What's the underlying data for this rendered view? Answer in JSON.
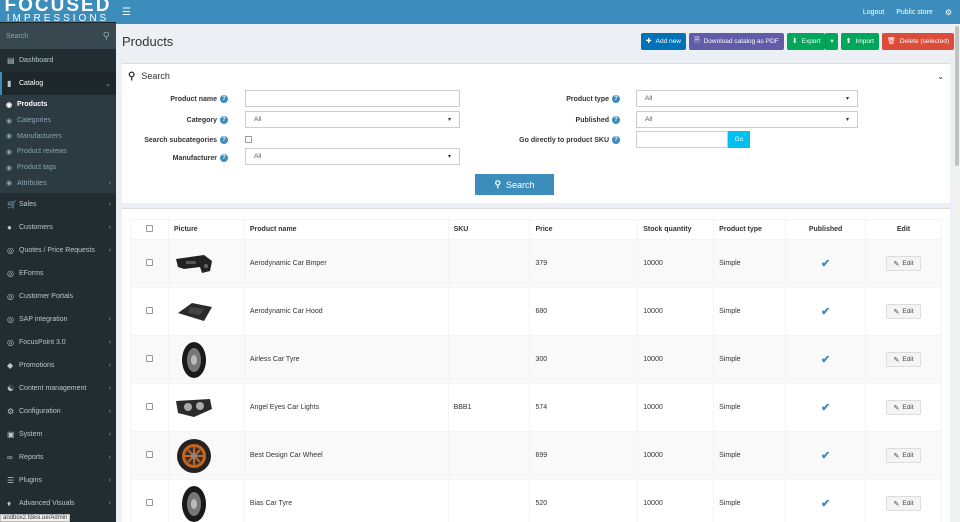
{
  "brand": {
    "line1": "FOCUSED",
    "line2": "IMPRESSIONS"
  },
  "sidebar": {
    "search_placeholder": "Search",
    "items": [
      {
        "label": "Dashboard",
        "icon": "dashboard-icon",
        "chevron": ""
      },
      {
        "label": "Catalog",
        "icon": "book-icon",
        "chevron": "⌄",
        "active": true
      },
      {
        "label": "Sales",
        "icon": "cart-icon",
        "chevron": "‹"
      },
      {
        "label": "Customers",
        "icon": "user-icon",
        "chevron": "‹"
      },
      {
        "label": "Quotes / Price Requests",
        "icon": "circle-icon",
        "chevron": "‹"
      },
      {
        "label": "EForms",
        "icon": "circle-icon",
        "chevron": ""
      },
      {
        "label": "Customer Portals",
        "icon": "circle-icon",
        "chevron": ""
      },
      {
        "label": "SAP integration",
        "icon": "circle-icon",
        "chevron": "‹"
      },
      {
        "label": "FocusPoint 3.0",
        "icon": "circle-icon",
        "chevron": "‹"
      },
      {
        "label": "Promotions",
        "icon": "tag-icon",
        "chevron": "‹"
      },
      {
        "label": "Content management",
        "icon": "sitemap-icon",
        "chevron": "‹"
      },
      {
        "label": "Configuration",
        "icon": "gears-icon",
        "chevron": "‹"
      },
      {
        "label": "System",
        "icon": "cube-icon",
        "chevron": "‹"
      },
      {
        "label": "Reports",
        "icon": "chart-icon",
        "chevron": "‹"
      },
      {
        "label": "Plugins",
        "icon": "bars-icon",
        "chevron": "‹"
      },
      {
        "label": "Advanced Visuals",
        "icon": "diamond-icon",
        "chevron": "‹"
      }
    ],
    "catalog_sub": [
      {
        "label": "Products",
        "active": true,
        "chevron": ""
      },
      {
        "label": "Categories",
        "chevron": ""
      },
      {
        "label": "Manufacturers",
        "chevron": ""
      },
      {
        "label": "Product reviews",
        "chevron": ""
      },
      {
        "label": "Product tags",
        "chevron": ""
      },
      {
        "label": "Attributes",
        "chevron": "‹"
      }
    ]
  },
  "url_tooltip": "andbox2.fdesi.ue/Admin",
  "topbar": {
    "logout": "Logout",
    "public_store": "Public store"
  },
  "header": {
    "title": "Products",
    "add_new": "Add new",
    "download_pdf": "Download catalog as PDF",
    "export": "Export",
    "import": "Import",
    "delete_selected": "Delete (selected)"
  },
  "search": {
    "title": "Search",
    "product_name_label": "Product name",
    "product_name_value": "",
    "category_label": "Category",
    "category_value": "All",
    "search_subcategories_label": "Search subcategories",
    "manufacturer_label": "Manufacturer",
    "manufacturer_value": "All",
    "product_type_label": "Product type",
    "product_type_value": "All",
    "published_label": "Published",
    "published_value": "All",
    "go_sku_label": "Go directly to product SKU",
    "go_sku_value": "",
    "go_button": "Go",
    "search_button": "Search"
  },
  "table": {
    "columns": [
      "Picture",
      "Product name",
      "SKU",
      "Price",
      "Stock quantity",
      "Product type",
      "Published",
      "Edit"
    ],
    "edit_label": "Edit",
    "rows": [
      {
        "name": "Aerodynamic Car Bmper",
        "sku": "",
        "price": "379",
        "stock": "10000",
        "type": "Simple",
        "thumb": "bumper"
      },
      {
        "name": "Aerodynamic Car Hood",
        "sku": "",
        "price": "680",
        "stock": "10000",
        "type": "Simple",
        "thumb": "hood"
      },
      {
        "name": "Airless Car Tyre",
        "sku": "",
        "price": "300",
        "stock": "10000",
        "type": "Simple",
        "thumb": "tyre"
      },
      {
        "name": "Angel Eyes Car Lights",
        "sku": "BBB1",
        "price": "574",
        "stock": "10000",
        "type": "Simple",
        "thumb": "lights"
      },
      {
        "name": "Best Design Car Wheel",
        "sku": "",
        "price": "699",
        "stock": "10000",
        "type": "Simple",
        "thumb": "wheel"
      },
      {
        "name": "Bias Car Tyre",
        "sku": "",
        "price": "520",
        "stock": "10000",
        "type": "Simple",
        "thumb": "tyre"
      }
    ]
  },
  "colors": {
    "primary": "#3c8dbc",
    "sidebar": "#222d32",
    "green": "#00a65a",
    "red": "#dd4b39",
    "purple": "#605ca8"
  }
}
